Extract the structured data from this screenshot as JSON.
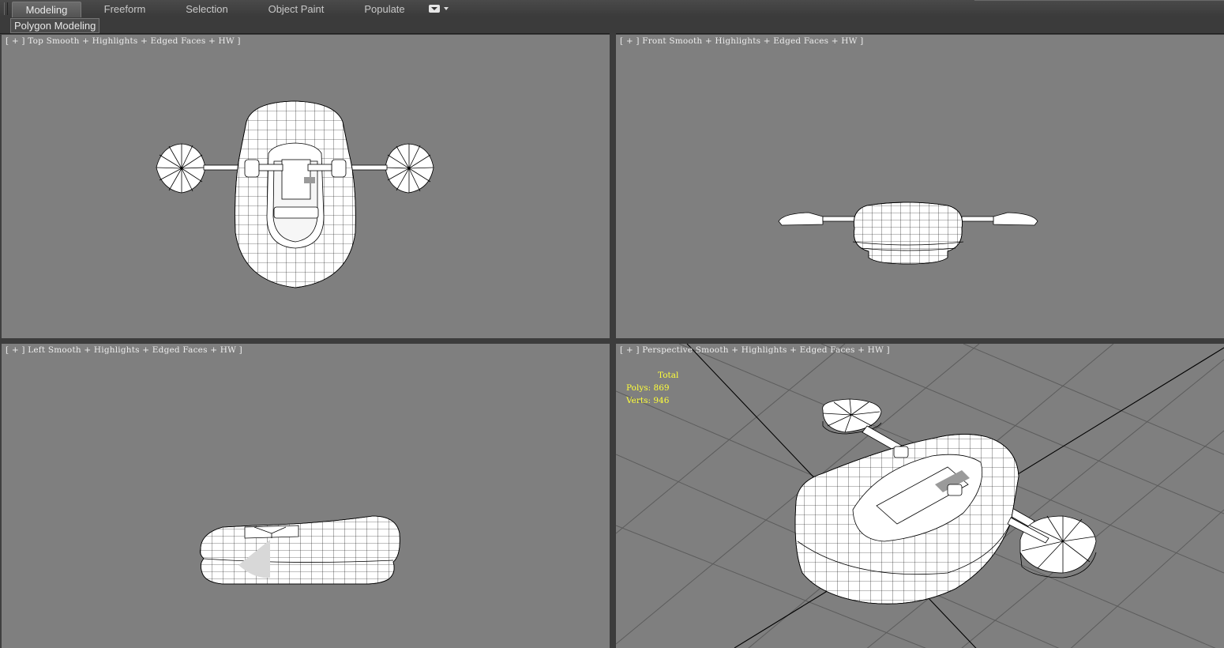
{
  "ribbon": {
    "tabs": [
      {
        "label": "Modeling",
        "active": true
      },
      {
        "label": "Freeform",
        "active": false
      },
      {
        "label": "Selection",
        "active": false
      },
      {
        "label": "Object Paint",
        "active": false
      },
      {
        "label": "Populate",
        "active": false
      }
    ],
    "sub_panel_label": "Polygon Modeling"
  },
  "viewports": {
    "top": {
      "plus": "[ + ]",
      "view": "Top",
      "shading": "Smooth + Highlights + Edged Faces + HW ]"
    },
    "front": {
      "plus": "[ + ]",
      "view": "Front",
      "shading": "Smooth + Highlights + Edged Faces + HW ]"
    },
    "left": {
      "plus": "[ + ]",
      "view": "Left",
      "shading": "Smooth + Highlights + Edged Faces + HW ]"
    },
    "perspective": {
      "plus": "[ + ]",
      "view": "Perspective",
      "shading": "Smooth + Highlights + Edged Faces + HW ]"
    }
  },
  "statistics": {
    "heading": "Total",
    "polys_label": "Polys:",
    "polys_value": "869",
    "verts_label": "Verts:",
    "verts_value": "946",
    "color": "#ffff3a"
  },
  "colors": {
    "viewport_bg": "#7f7f7f",
    "ui_bg": "#3f3f3f",
    "model": "#ffffff",
    "wire": "#000000"
  }
}
